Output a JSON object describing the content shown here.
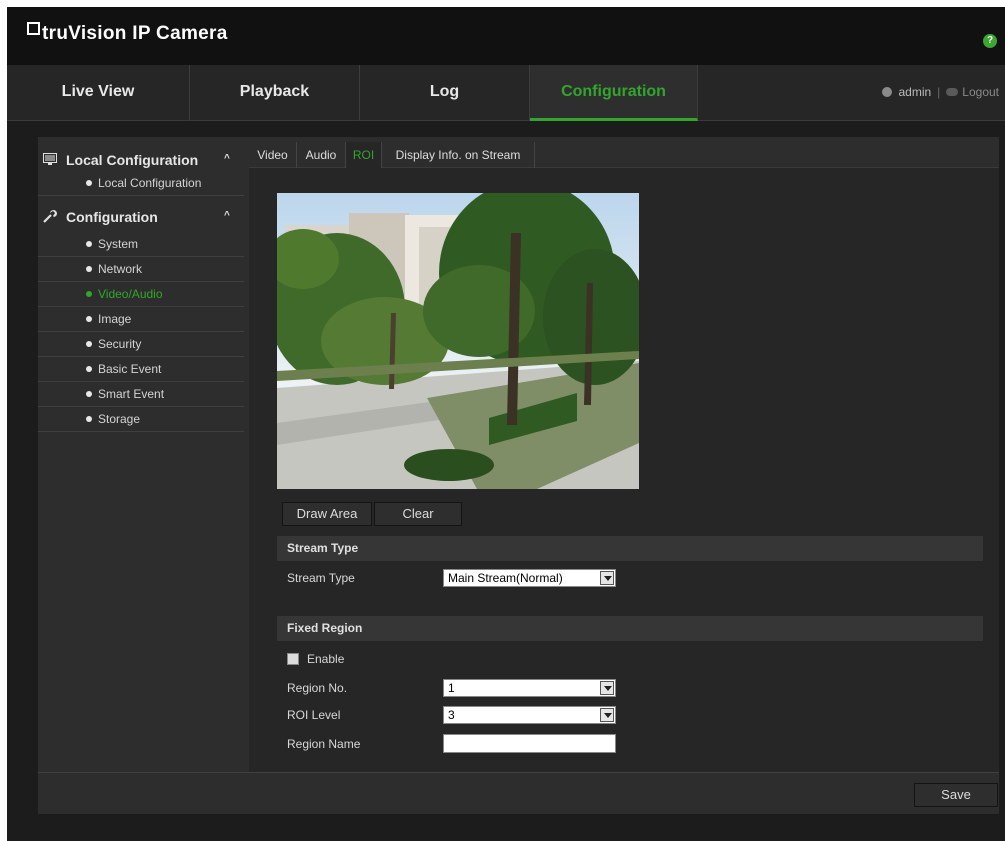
{
  "header": {
    "app_title": "truVision IP Camera",
    "help_icon": "help-icon",
    "help_glyph": "?"
  },
  "nav": {
    "tabs": [
      {
        "label": "Live View",
        "active": false
      },
      {
        "label": "Playback",
        "active": false
      },
      {
        "label": "Log",
        "active": false
      },
      {
        "label": "Configuration",
        "active": true
      }
    ],
    "user": "admin",
    "separator": "|",
    "logout": "Logout"
  },
  "sidebar": {
    "sections": [
      {
        "label": "Local Configuration",
        "icon": "local-config-icon",
        "expanded": true,
        "chevron": "^"
      },
      {
        "label": "Configuration",
        "icon": "wrench-icon",
        "expanded": true,
        "chevron": "^"
      }
    ],
    "local_items": [
      {
        "label": "Local Configuration"
      }
    ],
    "config_items": [
      {
        "label": "System"
      },
      {
        "label": "Network"
      },
      {
        "label": "Video/Audio",
        "active": true
      },
      {
        "label": "Image"
      },
      {
        "label": "Security"
      },
      {
        "label": "Basic Event"
      },
      {
        "label": "Smart Event"
      },
      {
        "label": "Storage"
      }
    ]
  },
  "tabs": [
    {
      "label": "Video"
    },
    {
      "label": "Audio"
    },
    {
      "label": "ROI",
      "active": true
    },
    {
      "label": "Display Info. on Stream"
    }
  ],
  "buttons": {
    "draw_area": "Draw Area",
    "clear": "Clear",
    "save": "Save"
  },
  "stream_section": {
    "title": "Stream Type",
    "label": "Stream Type",
    "value": "Main Stream(Normal)"
  },
  "fixed_region": {
    "title": "Fixed Region",
    "enable_label": "Enable",
    "enable_checked": false,
    "region_no_label": "Region No.",
    "region_no_value": "1",
    "roi_level_label": "ROI Level",
    "roi_level_value": "3",
    "region_name_label": "Region Name",
    "region_name_value": ""
  },
  "colors": {
    "accent": "#2fa82a",
    "background": "#1c1c1c",
    "panel": "#2d2d2d"
  }
}
